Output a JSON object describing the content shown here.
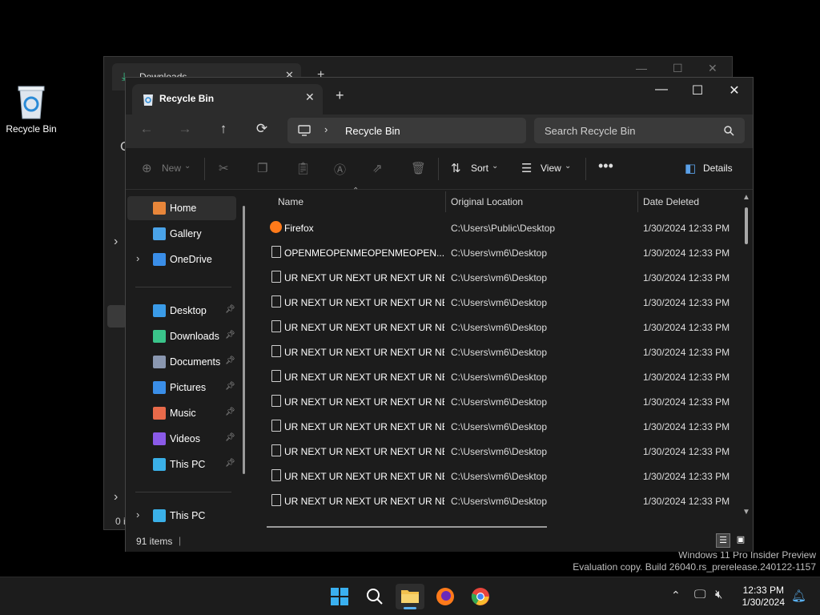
{
  "desktop": {
    "icon_label": "Recycle Bin"
  },
  "watermark": {
    "line1": "Windows 11 Pro Insider Preview",
    "line2": "Evaluation copy. Build 26040.rs_prerelease.240122-1157"
  },
  "back_window": {
    "tab_title": "Downloads",
    "status_fragment": "0 i"
  },
  "window": {
    "tab_title": "Recycle Bin",
    "address": {
      "segment": "Recycle Bin"
    },
    "search": {
      "placeholder": "Search Recycle Bin"
    },
    "toolbar": {
      "new_label": "New",
      "sort_label": "Sort",
      "view_label": "View",
      "details_label": "Details"
    },
    "sidebar": {
      "top": [
        {
          "label": "Home",
          "icon": "home-icon",
          "color": "#e8863a"
        },
        {
          "label": "Gallery",
          "icon": "gallery-icon",
          "color": "#4aa3e8"
        },
        {
          "label": "OneDrive",
          "icon": "cloud-icon",
          "color": "#3a8ee8"
        }
      ],
      "quick": [
        {
          "label": "Desktop",
          "icon": "desktop-icon",
          "color": "#3a9be8"
        },
        {
          "label": "Downloads",
          "icon": "download-icon",
          "color": "#3ac48a"
        },
        {
          "label": "Documents",
          "icon": "documents-icon",
          "color": "#8a97b0"
        },
        {
          "label": "Pictures",
          "icon": "pictures-icon",
          "color": "#3a8ee8"
        },
        {
          "label": "Music",
          "icon": "music-icon",
          "color": "#e86a4a"
        },
        {
          "label": "Videos",
          "icon": "videos-icon",
          "color": "#8a5ae8"
        },
        {
          "label": "This PC",
          "icon": "pc-icon",
          "color": "#3ab0e8"
        }
      ],
      "bottom": [
        {
          "label": "This PC",
          "icon": "pc-icon",
          "color": "#3ab0e8"
        }
      ]
    },
    "columns": {
      "name": "Name",
      "location": "Original Location",
      "date": "Date Deleted"
    },
    "rows": [
      {
        "name": "Firefox",
        "location": "C:\\Users\\Public\\Desktop",
        "date": "1/30/2024 12:33 PM"
      },
      {
        "name": "OPENMEOPENMEOPENMEOPEN...",
        "location": "C:\\Users\\vm6\\Desktop",
        "date": "1/30/2024 12:33 PM"
      },
      {
        "name": "UR NEXT UR NEXT UR NEXT UR NE...",
        "location": "C:\\Users\\vm6\\Desktop",
        "date": "1/30/2024 12:33 PM"
      },
      {
        "name": "UR NEXT UR NEXT UR NEXT UR NE...",
        "location": "C:\\Users\\vm6\\Desktop",
        "date": "1/30/2024 12:33 PM"
      },
      {
        "name": "UR NEXT UR NEXT UR NEXT UR NE...",
        "location": "C:\\Users\\vm6\\Desktop",
        "date": "1/30/2024 12:33 PM"
      },
      {
        "name": "UR NEXT UR NEXT UR NEXT UR NE...",
        "location": "C:\\Users\\vm6\\Desktop",
        "date": "1/30/2024 12:33 PM"
      },
      {
        "name": "UR NEXT UR NEXT UR NEXT UR NE...",
        "location": "C:\\Users\\vm6\\Desktop",
        "date": "1/30/2024 12:33 PM"
      },
      {
        "name": "UR NEXT UR NEXT UR NEXT UR NE...",
        "location": "C:\\Users\\vm6\\Desktop",
        "date": "1/30/2024 12:33 PM"
      },
      {
        "name": "UR NEXT UR NEXT UR NEXT UR NE...",
        "location": "C:\\Users\\vm6\\Desktop",
        "date": "1/30/2024 12:33 PM"
      },
      {
        "name": "UR NEXT UR NEXT UR NEXT UR NE...",
        "location": "C:\\Users\\vm6\\Desktop",
        "date": "1/30/2024 12:33 PM"
      },
      {
        "name": "UR NEXT UR NEXT UR NEXT UR NE...",
        "location": "C:\\Users\\vm6\\Desktop",
        "date": "1/30/2024 12:33 PM"
      },
      {
        "name": "UR NEXT UR NEXT UR NEXT UR NE...",
        "location": "C:\\Users\\vm6\\Desktop",
        "date": "1/30/2024 12:33 PM"
      }
    ],
    "status": {
      "item_count": "91 items"
    }
  },
  "taskbar": {
    "apps": [
      "start-icon",
      "search-icon",
      "file-explorer-icon",
      "firefox-icon",
      "chrome-icon"
    ],
    "time": "12:33 PM",
    "date": "1/30/2024"
  }
}
